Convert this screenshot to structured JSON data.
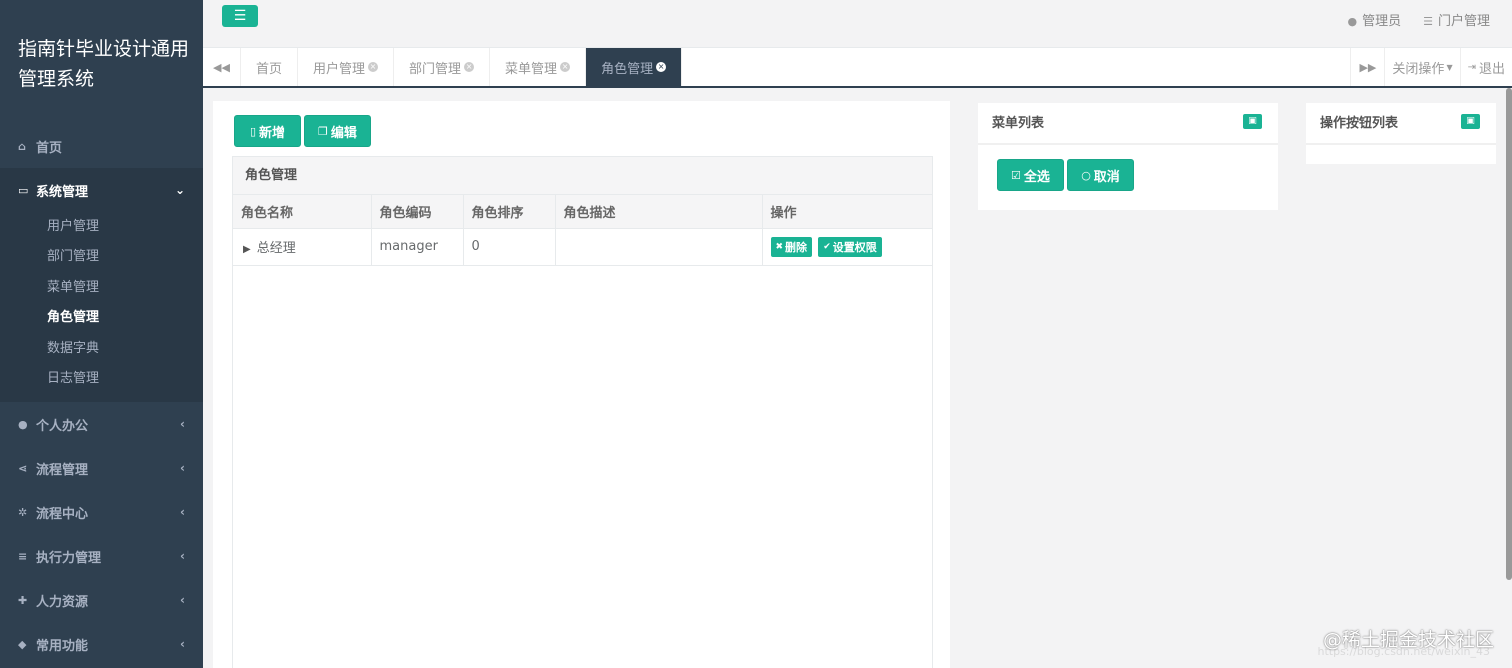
{
  "app": {
    "title": "指南针毕业设计通用管理系统"
  },
  "sidebar": {
    "items": [
      {
        "label": "首页",
        "icon": "home-icon",
        "glyph": "⌂"
      },
      {
        "label": "系统管理",
        "icon": "monitor-icon",
        "glyph": "▭",
        "arrow": "⌄",
        "children": [
          "用户管理",
          "部门管理",
          "菜单管理",
          "角色管理",
          "数据字典",
          "日志管理"
        ]
      },
      {
        "label": "个人办公",
        "icon": "user-icon",
        "glyph": "●",
        "arrow": "‹"
      },
      {
        "label": "流程管理",
        "icon": "share-icon",
        "glyph": "⋖",
        "arrow": "‹"
      },
      {
        "label": "流程中心",
        "icon": "gear-icon",
        "glyph": "✲",
        "arrow": "‹"
      },
      {
        "label": "执行力管理",
        "icon": "tasks-icon",
        "glyph": "≡",
        "arrow": "‹"
      },
      {
        "label": "人力资源",
        "icon": "user-plus-icon",
        "glyph": "✚",
        "arrow": "‹"
      },
      {
        "label": "常用功能",
        "icon": "cubes-icon",
        "glyph": "◆",
        "arrow": "‹"
      }
    ],
    "active_child": "角色管理"
  },
  "topbar": {
    "toggle_glyph": "☰",
    "user_label": "管理员",
    "portal_label": "门户管理"
  },
  "tabs": {
    "back_glyph": "◀◀",
    "forward_glyph": "▶▶",
    "items": [
      {
        "label": "首页",
        "closable": false
      },
      {
        "label": "用户管理",
        "closable": true
      },
      {
        "label": "部门管理",
        "closable": true
      },
      {
        "label": "菜单管理",
        "closable": true
      },
      {
        "label": "角色管理",
        "closable": true,
        "active": true
      }
    ],
    "close_ops_label": "关闭操作",
    "logout_label": "退出"
  },
  "role_panel": {
    "add_label": "新增",
    "edit_label": "编辑",
    "table_title": "角色管理",
    "columns": [
      "角色名称",
      "角色编码",
      "角色排序",
      "角色描述",
      "操作"
    ],
    "rows": [
      {
        "name": "总经理",
        "code": "manager",
        "sort": "0",
        "desc": ""
      }
    ],
    "delete_label": "删除",
    "perm_label": "设置权限"
  },
  "menu_panel": {
    "title": "菜单列表",
    "select_all_label": "全选",
    "cancel_label": "取消"
  },
  "button_panel": {
    "title": "操作按钮列表"
  },
  "watermark": {
    "text": "@稀土掘金技术社区",
    "url": "https://blog.csdn.net/weixin_43"
  },
  "colors": {
    "accent": "#1ab394",
    "sidebar": "#2f4050"
  }
}
